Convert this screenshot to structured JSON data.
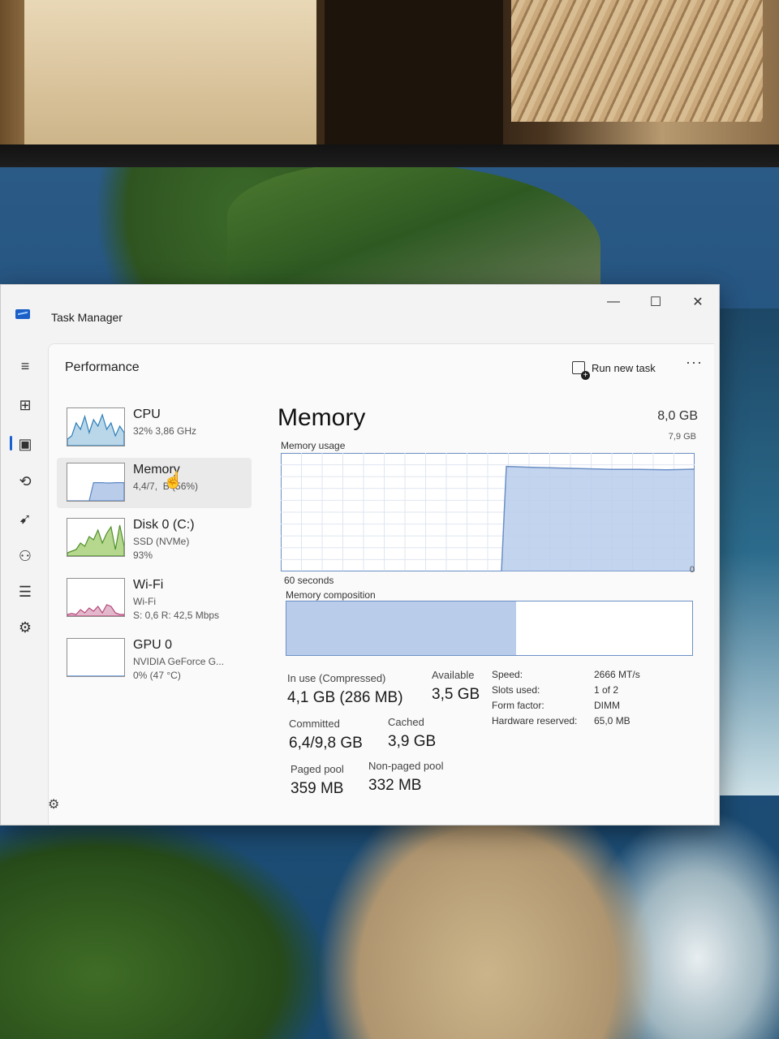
{
  "window": {
    "title": "Task Manager",
    "minimize": "—",
    "maximize": "☐",
    "close": "✕"
  },
  "rail": [
    {
      "name": "hamburger-icon",
      "glyph": "≡"
    },
    {
      "name": "processes-icon",
      "glyph": "⊞"
    },
    {
      "name": "performance-icon",
      "glyph": "▣"
    },
    {
      "name": "app-history-icon",
      "glyph": "⟲"
    },
    {
      "name": "startup-apps-icon",
      "glyph": "➹"
    },
    {
      "name": "users-icon",
      "glyph": "⚇"
    },
    {
      "name": "details-icon",
      "glyph": "☰"
    },
    {
      "name": "services-icon",
      "glyph": "⚙"
    }
  ],
  "header": {
    "title": "Performance",
    "run_new_task": "Run new task",
    "more": "···"
  },
  "resources": [
    {
      "name": "CPU",
      "line1": "32% 3,86 GHz",
      "line2": "",
      "color": "#2d7fb8",
      "fill": "#bad7ea",
      "level": 0.32
    },
    {
      "name": "Memory",
      "line1": "4,4/7,",
      "line2_hidden": "9 G",
      "line1b": "B (56%)",
      "color": "#5a85c6",
      "fill": "#b9cdeb",
      "level": 0.56
    },
    {
      "name": "Disk 0 (C:)",
      "line1": "SSD (NVMe)",
      "line2": "93%",
      "color": "#4e8f2a",
      "fill": "#b6d78e",
      "level": 0.93
    },
    {
      "name": "Wi-Fi",
      "line1": "Wi-Fi",
      "line2": "S: 0,6 R: 42,5 Mbps",
      "color": "#b2487a",
      "fill": "#e4b8cc",
      "level": 0.2
    },
    {
      "name": "GPU 0",
      "line1": "NVIDIA GeForce G...",
      "line2": "0% (47 °C)",
      "color": "#3a7bd5",
      "fill": "#cfe0f5",
      "level": 0.0
    }
  ],
  "memory": {
    "title": "Memory",
    "total": "8,0 GB",
    "usage_label": "Memory usage",
    "usage_max": "7,9 GB",
    "axis_left": "60 seconds",
    "axis_right": "0",
    "composition_label": "Memory composition",
    "stats": {
      "in_use_label": "In use (Compressed)",
      "in_use": "4,1 GB (286 MB)",
      "available_label": "Available",
      "available": "3,5 GB",
      "committed_label": "Committed",
      "committed": "6,4/9,8 GB",
      "cached_label": "Cached",
      "cached": "3,9 GB",
      "paged_label": "Paged pool",
      "paged": "359 MB",
      "nonpaged_label": "Non-paged pool",
      "nonpaged": "332 MB"
    },
    "specs": [
      {
        "k": "Speed:",
        "v": "2666 MT/s"
      },
      {
        "k": "Slots used:",
        "v": "1 of 2"
      },
      {
        "k": "Form factor:",
        "v": "DIMM"
      },
      {
        "k": "Hardware reserved:",
        "v": "65,0 MB"
      }
    ],
    "composition": {
      "in_use": 0.52,
      "modified": 0.045,
      "standby": 0.435,
      "in_use_color": "#b9cdeb",
      "border": "#6b8fc6"
    }
  },
  "chart_data": {
    "type": "area",
    "title": "Memory usage",
    "xlabel": "60 seconds",
    "ylim": [
      0,
      7.9
    ],
    "x": [
      60,
      56,
      52,
      48,
      44,
      40,
      36,
      32,
      28,
      26,
      24,
      20,
      16,
      12,
      8,
      4,
      0
    ],
    "values": [
      0,
      0,
      0,
      0,
      0,
      0,
      0,
      0,
      0,
      7.0,
      6.95,
      6.9,
      6.85,
      6.8,
      6.8,
      6.78,
      6.82
    ],
    "series_color": "#6b8fc6",
    "fill": "#b9cdeb"
  }
}
